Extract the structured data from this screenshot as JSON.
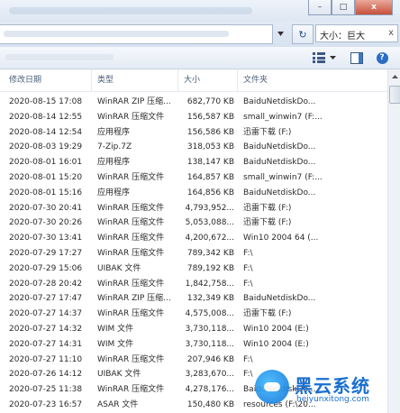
{
  "window": {
    "minimize_glyph": "–",
    "maximize_glyph": "□",
    "close_glyph": "x"
  },
  "search": {
    "value": "大小：巨大",
    "refresh_glyph": "↻",
    "clear_glyph": "x"
  },
  "toolbar": {
    "views_icon": "views-icon",
    "preview_icon": "preview-pane-icon",
    "help_icon": "help-icon",
    "help_glyph": "?"
  },
  "columns": {
    "date": "修改日期",
    "type": "类型",
    "size": "大小",
    "folder": "文件夹"
  },
  "rows": [
    {
      "date": "2020-08-15 17:08",
      "type": "WinRAR ZIP 压缩...",
      "size": "682,770 KB",
      "folder": "BaiduNetdiskDo..."
    },
    {
      "date": "2020-08-14 12:55",
      "type": "WinRAR 压缩文件",
      "size": "156,587 KB",
      "folder": "small_winwin7 (F:..."
    },
    {
      "date": "2020-08-14 12:54",
      "type": "应用程序",
      "size": "156,586 KB",
      "folder": "迅雷下载 (F:)"
    },
    {
      "date": "2020-08-03 19:29",
      "type": "7-Zip.7Z",
      "size": "318,053 KB",
      "folder": "BaiduNetdiskDo..."
    },
    {
      "date": "2020-08-01 16:01",
      "type": "应用程序",
      "size": "138,147 KB",
      "folder": "BaiduNetdiskDo..."
    },
    {
      "date": "2020-08-01 15:20",
      "type": "WinRAR 压缩文件",
      "size": "164,857 KB",
      "folder": "small_winwin7 (F:..."
    },
    {
      "date": "2020-08-01 15:16",
      "type": "应用程序",
      "size": "164,856 KB",
      "folder": "BaiduNetdiskDo..."
    },
    {
      "date": "2020-07-30 20:41",
      "type": "WinRAR 压缩文件",
      "size": "4,793,952...",
      "folder": "迅雷下载 (F:)"
    },
    {
      "date": "2020-07-30 20:26",
      "type": "WinRAR 压缩文件",
      "size": "5,053,088...",
      "folder": "迅雷下载 (F:)"
    },
    {
      "date": "2020-07-30 13:41",
      "type": "WinRAR 压缩文件",
      "size": "4,200,672...",
      "folder": "Win10 2004 64 (..."
    },
    {
      "date": "2020-07-29 17:27",
      "type": "WinRAR 压缩文件",
      "size": "789,342 KB",
      "folder": "F:\\"
    },
    {
      "date": "2020-07-29 15:06",
      "type": "UIBAK 文件",
      "size": "789,192 KB",
      "folder": "F:\\"
    },
    {
      "date": "2020-07-28 20:42",
      "type": "WinRAR 压缩文件",
      "size": "1,842,758...",
      "folder": "F:\\"
    },
    {
      "date": "2020-07-27 17:47",
      "type": "WinRAR ZIP 压缩...",
      "size": "132,349 KB",
      "folder": "BaiduNetdiskDo..."
    },
    {
      "date": "2020-07-27 14:37",
      "type": "WinRAR 压缩文件",
      "size": "4,575,008...",
      "folder": "迅雷下载 (F:)"
    },
    {
      "date": "2020-07-27 14:32",
      "type": "WIM 文件",
      "size": "3,730,118...",
      "folder": "Win10 2004 (E:)"
    },
    {
      "date": "2020-07-27 14:31",
      "type": "WIM 文件",
      "size": "3,730,118...",
      "folder": "Win10 2004 (E:)"
    },
    {
      "date": "2020-07-27 11:10",
      "type": "WinRAR 压缩文件",
      "size": "207,946 KB",
      "folder": "F:\\"
    },
    {
      "date": "2020-07-26 14:12",
      "type": "UIBAK 文件",
      "size": "3,283,670...",
      "folder": "F:\\"
    },
    {
      "date": "2020-07-25 11:38",
      "type": "WinRAR 压缩文件",
      "size": "4,278,176...",
      "folder": "BaiduNetdiskDo..."
    },
    {
      "date": "2020-07-23 16:57",
      "type": "ASAR 文件",
      "size": "150,480 KB",
      "folder": "resources (F:\\20..."
    }
  ],
  "watermark": {
    "title": "黑云系统",
    "url": "heiyunxitong.com"
  }
}
